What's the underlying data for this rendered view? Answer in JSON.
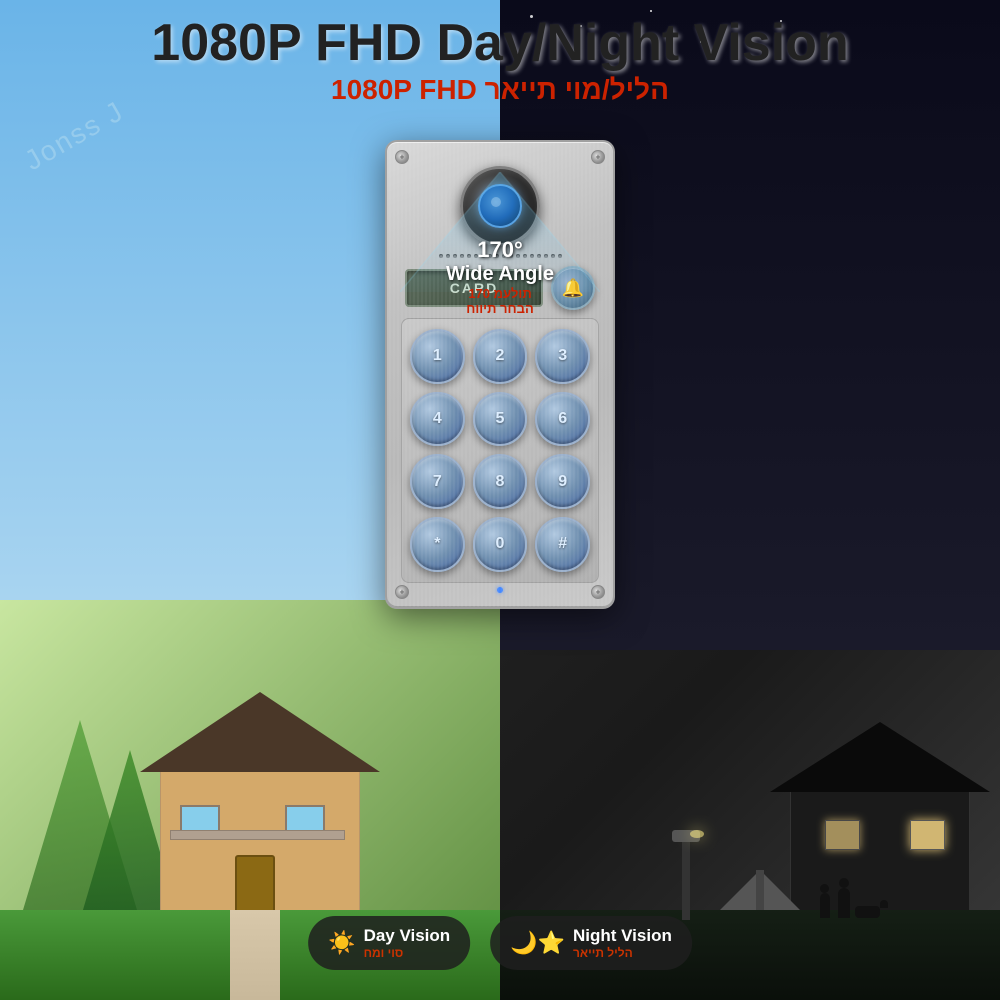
{
  "header": {
    "title_main": "1080P FHD Day/Night Vision",
    "title_hebrew": "1080P FHD הליל/מוי תייאר"
  },
  "camera": {
    "angle_degrees": "170°",
    "angle_label": "Wide Angle",
    "angle_hebrew_line1": "תולעמ 170",
    "angle_hebrew_line2": "הבחר תיווח"
  },
  "card_reader": {
    "label": "CARD"
  },
  "keypad": {
    "keys": [
      "1",
      "2",
      "3",
      "4",
      "5",
      "6",
      "7",
      "8",
      "9",
      "*",
      "0",
      "#"
    ]
  },
  "badges": {
    "day": {
      "icon": "☀",
      "title": "Day Vision",
      "hebrew": "סוי ומח"
    },
    "night": {
      "icon": "☽★",
      "title": "Night Vision",
      "hebrew": "הליל תייאר"
    }
  },
  "watermark": "Jonss J",
  "colors": {
    "accent_red": "#cc2200",
    "accent_blue": "#4488cc",
    "panel_silver": "#c8c8c8"
  }
}
